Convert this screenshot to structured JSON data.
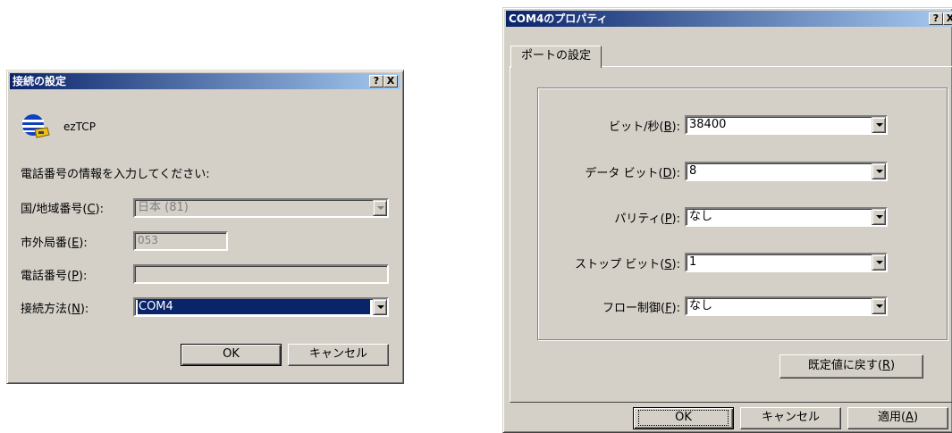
{
  "dialog1": {
    "title": "接続の設定",
    "help_btn": "?",
    "close_btn": "X",
    "connection_name": "ezTCP",
    "instruction": "電話番号の情報を入力してください:",
    "country_label_pre": "国/地域番号(",
    "country_key": "C",
    "country_label_post": "):",
    "country_value": "日本 (81)",
    "area_label_pre": "市外局番(",
    "area_key": "E",
    "area_label_post": "):",
    "area_value": "053",
    "phone_label_pre": "電話番号(",
    "phone_key": "P",
    "phone_label_post": "):",
    "phone_value": "",
    "method_label_pre": "接続方法(",
    "method_key": "N",
    "method_label_post": "):",
    "method_value": "COM4",
    "ok": "OK",
    "cancel": "キャンセル"
  },
  "dialog2": {
    "title": "COM4のプロパティ",
    "help_btn": "?",
    "close_btn": "X",
    "tab": "ポートの設定",
    "rows": [
      {
        "label_pre": "ビット/秒(",
        "key": "B",
        "label_post": "):",
        "value": "38400"
      },
      {
        "label_pre": "データ ビット(",
        "key": "D",
        "label_post": "):",
        "value": "8"
      },
      {
        "label_pre": "パリティ(",
        "key": "P",
        "label_post": "):",
        "value": "なし"
      },
      {
        "label_pre": "ストップ ビット(",
        "key": "S",
        "label_post": "):",
        "value": "1"
      },
      {
        "label_pre": "フロー制御(",
        "key": "F",
        "label_post": "):",
        "value": "なし"
      }
    ],
    "restore_pre": "既定値に戻す(",
    "restore_key": "R",
    "restore_post": ")",
    "ok": "OK",
    "cancel": "キャンセル",
    "apply_pre": "適用(",
    "apply_key": "A",
    "apply_post": ")"
  }
}
